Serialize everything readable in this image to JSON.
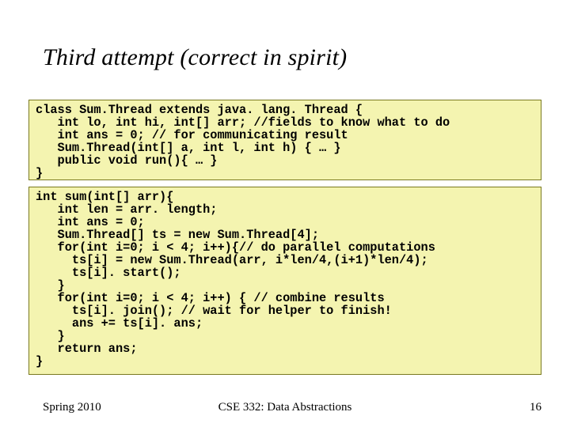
{
  "title": "Third attempt (correct in spirit)",
  "code": {
    "block1": "class Sum.Thread extends java. lang. Thread {\n   int lo, int hi, int[] arr; //fields to know what to do\n   int ans = 0; // for communicating result\n   Sum.Thread(int[] a, int l, int h) { … }\n   public void run(){ … }\n}",
    "block2": "int sum(int[] arr){\n   int len = arr. length;\n   int ans = 0;\n   Sum.Thread[] ts = new Sum.Thread[4];\n   for(int i=0; i < 4; i++){// do parallel computations\n     ts[i] = new Sum.Thread(arr, i*len/4,(i+1)*len/4);\n     ts[i]. start();\n   }\n   for(int i=0; i < 4; i++) { // combine results\n     ts[i]. join(); // wait for helper to finish!\n     ans += ts[i]. ans;\n   }\n   return ans;\n}"
  },
  "footer": {
    "left": "Spring 2010",
    "center": "CSE 332: Data Abstractions",
    "right": "16"
  }
}
